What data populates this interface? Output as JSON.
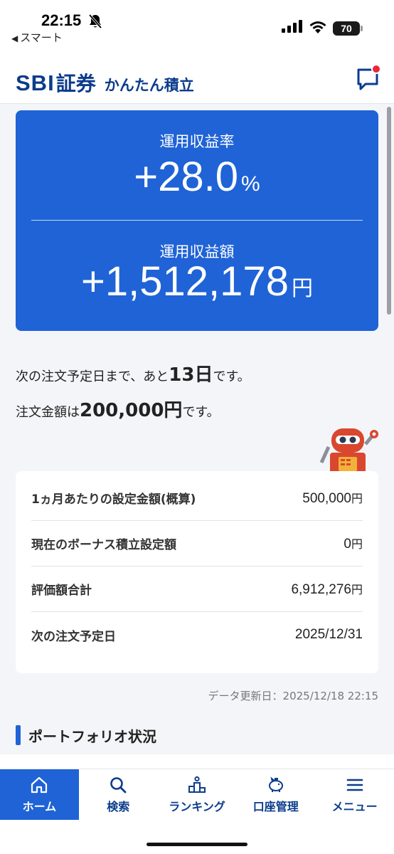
{
  "status_bar": {
    "time": "22:15",
    "back_app": "スマート",
    "battery": "70"
  },
  "header": {
    "logo_sbi": "SBI",
    "logo_shoken": "証券",
    "logo_service": "かんたん積立"
  },
  "summary": {
    "return_rate_label": "運用収益率",
    "return_rate_value": "+28.0",
    "return_rate_unit": "%",
    "return_amount_label": "運用収益額",
    "return_amount_value": "+1,512,178",
    "return_amount_unit": "円"
  },
  "notice": {
    "line1_pre": "次の注文予定日まで、あと",
    "days": "13日",
    "line1_post": "です。",
    "line2_pre": "注文金額は",
    "amount": "200,000円",
    "line2_post": "です。"
  },
  "info": {
    "rows": [
      {
        "label": "1ヵ月あたりの設定金額(概算)",
        "value": "500,000",
        "unit": "円"
      },
      {
        "label": "現在のボーナス積立設定額",
        "value": "0",
        "unit": "円"
      },
      {
        "label": "評価額合計",
        "value": "6,912,276",
        "unit": "円"
      },
      {
        "label": "次の注文予定日",
        "value": "2025/12/31",
        "unit": ""
      }
    ]
  },
  "updated": "データ更新日：2025/12/18 22:15",
  "section_title": "ポートフォリオ状況",
  "nav": {
    "items": [
      {
        "label": "ホーム",
        "icon": "home-icon"
      },
      {
        "label": "検索",
        "icon": "search-icon"
      },
      {
        "label": "ランキング",
        "icon": "ranking-icon"
      },
      {
        "label": "口座管理",
        "icon": "piggy-bank-icon"
      },
      {
        "label": "メニュー",
        "icon": "menu-icon"
      }
    ]
  },
  "colors": {
    "brand_blue": "#1f63d6",
    "logo_navy": "#0b3c8c",
    "notification_red": "#e8263c"
  }
}
